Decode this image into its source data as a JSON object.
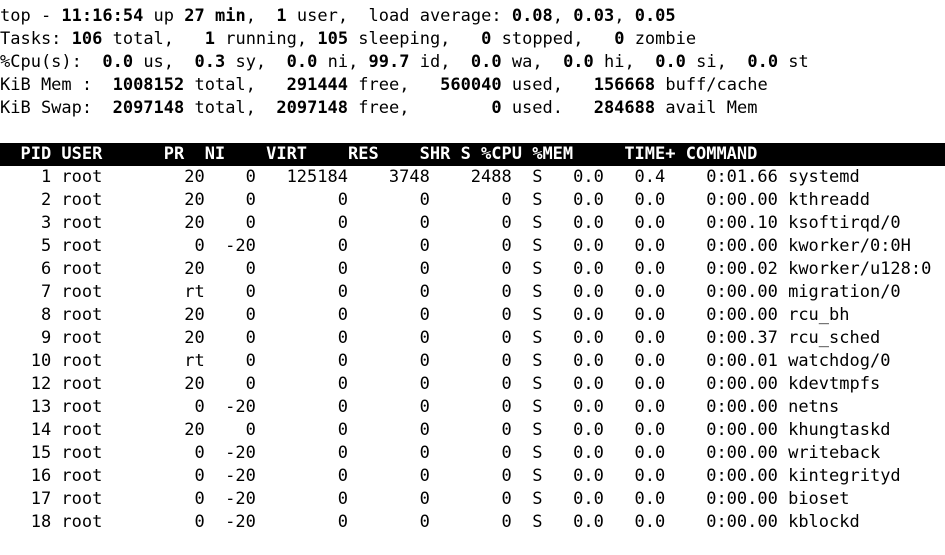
{
  "terminal": {
    "program": "top",
    "background_color": "#ffffff",
    "foreground_color": "#000000",
    "header_bar_background": "#000000",
    "header_bar_foreground": "#ffffff"
  },
  "summary": {
    "uptime_line": {
      "program": "top",
      "separator": "-",
      "time": "11:16:54",
      "up_label": "up",
      "uptime": "27 min,",
      "users_count": "1",
      "users_label": "user,",
      "load_label": "load average:",
      "load_1min": "0.08,",
      "load_5min": "0.03,",
      "load_15min": "0.05",
      "full_text": "top - 11:16:54 up 27 min,  1 user,  load average: 0.08, 0.03, 0.05"
    },
    "tasks_line": {
      "label": "Tasks:",
      "total": "106",
      "total_label": "total,",
      "running": "1",
      "running_label": "running,",
      "sleeping": "105",
      "sleeping_label": "sleeping,",
      "stopped": "0",
      "stopped_label": "stopped,",
      "zombie": "0",
      "zombie_label": "zombie",
      "full_text": "Tasks: 106 total,   1 running, 105 sleeping,   0 stopped,   0 zombie"
    },
    "cpu_line": {
      "label": "%Cpu(s):",
      "us": "0.0",
      "us_label": "us,",
      "sy": "0.3",
      "sy_label": "sy,",
      "ni": "0.0",
      "ni_label": "ni,",
      "id": "99.7",
      "id_label": "id,",
      "wa": "0.0",
      "wa_label": "wa,",
      "hi": "0.0",
      "hi_label": "hi,",
      "si": "0.0",
      "si_label": "si,",
      "st": "0.0",
      "st_label": "st",
      "full_text": "%Cpu(s):  0.0 us,  0.3 sy,  0.0 ni, 99.7 id,  0.0 wa,  0.0 hi,  0.0 si,  0.0 st"
    },
    "mem_line": {
      "label": "KiB Mem :",
      "total": "1008152",
      "total_label": "total,",
      "free": "291444",
      "free_label": "free,",
      "used": "560040",
      "used_label": "used,",
      "buff_cache": "156668",
      "buff_cache_label": "buff/cache",
      "full_text": "KiB Mem :  1008152 total,   291444 free,   560040 used,   156668 buff/cache"
    },
    "swap_line": {
      "label": "KiB Swap:",
      "total": "2097148",
      "total_label": "total,",
      "free": "2097148",
      "free_label": "free,",
      "used": "0",
      "used_label": "used.",
      "avail": "284688",
      "avail_label": "avail Mem",
      "full_text": "KiB Swap:  2097148 total,  2097148 free,        0 used.   284688 avail Mem"
    }
  },
  "table": {
    "columns": [
      {
        "key": "pid",
        "label": "PID",
        "width": 5,
        "align": "right"
      },
      {
        "key": "user",
        "label": "USER",
        "width": 9,
        "align": "left"
      },
      {
        "key": "pr",
        "label": "PR",
        "width": 4,
        "align": "right"
      },
      {
        "key": "ni",
        "label": "NI",
        "width": 4,
        "align": "right"
      },
      {
        "key": "virt",
        "label": "VIRT",
        "width": 8,
        "align": "right"
      },
      {
        "key": "res",
        "label": "RES",
        "width": 7,
        "align": "right"
      },
      {
        "key": "shr",
        "label": "SHR",
        "width": 7,
        "align": "right"
      },
      {
        "key": "s",
        "label": "S",
        "width": 2,
        "align": "right"
      },
      {
        "key": "cpu",
        "label": "%CPU",
        "width": 5,
        "align": "right"
      },
      {
        "key": "mem",
        "label": "%MEM",
        "width": 5,
        "align": "right"
      },
      {
        "key": "time",
        "label": "TIME+",
        "width": 10,
        "align": "right"
      },
      {
        "key": "command",
        "label": "COMMAND",
        "width": 0,
        "align": "left"
      }
    ],
    "header_text": "  PID USER      PR  NI    VIRT    RES    SHR S %CPU %MEM     TIME+ COMMAND                                       ",
    "rows": [
      {
        "pid": "1",
        "user": "root",
        "pr": "20",
        "ni": "0",
        "virt": "125184",
        "res": "3748",
        "shr": "2488",
        "s": "S",
        "cpu": "0.0",
        "mem": "0.4",
        "time": "0:01.66",
        "command": "systemd"
      },
      {
        "pid": "2",
        "user": "root",
        "pr": "20",
        "ni": "0",
        "virt": "0",
        "res": "0",
        "shr": "0",
        "s": "S",
        "cpu": "0.0",
        "mem": "0.0",
        "time": "0:00.00",
        "command": "kthreadd"
      },
      {
        "pid": "3",
        "user": "root",
        "pr": "20",
        "ni": "0",
        "virt": "0",
        "res": "0",
        "shr": "0",
        "s": "S",
        "cpu": "0.0",
        "mem": "0.0",
        "time": "0:00.10",
        "command": "ksoftirqd/0"
      },
      {
        "pid": "5",
        "user": "root",
        "pr": "0",
        "ni": "-20",
        "virt": "0",
        "res": "0",
        "shr": "0",
        "s": "S",
        "cpu": "0.0",
        "mem": "0.0",
        "time": "0:00.00",
        "command": "kworker/0:0H"
      },
      {
        "pid": "6",
        "user": "root",
        "pr": "20",
        "ni": "0",
        "virt": "0",
        "res": "0",
        "shr": "0",
        "s": "S",
        "cpu": "0.0",
        "mem": "0.0",
        "time": "0:00.02",
        "command": "kworker/u128:0"
      },
      {
        "pid": "7",
        "user": "root",
        "pr": "rt",
        "ni": "0",
        "virt": "0",
        "res": "0",
        "shr": "0",
        "s": "S",
        "cpu": "0.0",
        "mem": "0.0",
        "time": "0:00.00",
        "command": "migration/0"
      },
      {
        "pid": "8",
        "user": "root",
        "pr": "20",
        "ni": "0",
        "virt": "0",
        "res": "0",
        "shr": "0",
        "s": "S",
        "cpu": "0.0",
        "mem": "0.0",
        "time": "0:00.00",
        "command": "rcu_bh"
      },
      {
        "pid": "9",
        "user": "root",
        "pr": "20",
        "ni": "0",
        "virt": "0",
        "res": "0",
        "shr": "0",
        "s": "S",
        "cpu": "0.0",
        "mem": "0.0",
        "time": "0:00.37",
        "command": "rcu_sched"
      },
      {
        "pid": "10",
        "user": "root",
        "pr": "rt",
        "ni": "0",
        "virt": "0",
        "res": "0",
        "shr": "0",
        "s": "S",
        "cpu": "0.0",
        "mem": "0.0",
        "time": "0:00.01",
        "command": "watchdog/0"
      },
      {
        "pid": "12",
        "user": "root",
        "pr": "20",
        "ni": "0",
        "virt": "0",
        "res": "0",
        "shr": "0",
        "s": "S",
        "cpu": "0.0",
        "mem": "0.0",
        "time": "0:00.00",
        "command": "kdevtmpfs"
      },
      {
        "pid": "13",
        "user": "root",
        "pr": "0",
        "ni": "-20",
        "virt": "0",
        "res": "0",
        "shr": "0",
        "s": "S",
        "cpu": "0.0",
        "mem": "0.0",
        "time": "0:00.00",
        "command": "netns"
      },
      {
        "pid": "14",
        "user": "root",
        "pr": "20",
        "ni": "0",
        "virt": "0",
        "res": "0",
        "shr": "0",
        "s": "S",
        "cpu": "0.0",
        "mem": "0.0",
        "time": "0:00.00",
        "command": "khungtaskd"
      },
      {
        "pid": "15",
        "user": "root",
        "pr": "0",
        "ni": "-20",
        "virt": "0",
        "res": "0",
        "shr": "0",
        "s": "S",
        "cpu": "0.0",
        "mem": "0.0",
        "time": "0:00.00",
        "command": "writeback"
      },
      {
        "pid": "16",
        "user": "root",
        "pr": "0",
        "ni": "-20",
        "virt": "0",
        "res": "0",
        "shr": "0",
        "s": "S",
        "cpu": "0.0",
        "mem": "0.0",
        "time": "0:00.00",
        "command": "kintegrityd"
      },
      {
        "pid": "17",
        "user": "root",
        "pr": "0",
        "ni": "-20",
        "virt": "0",
        "res": "0",
        "shr": "0",
        "s": "S",
        "cpu": "0.0",
        "mem": "0.0",
        "time": "0:00.00",
        "command": "bioset"
      },
      {
        "pid": "18",
        "user": "root",
        "pr": "0",
        "ni": "-20",
        "virt": "0",
        "res": "0",
        "shr": "0",
        "s": "S",
        "cpu": "0.0",
        "mem": "0.0",
        "time": "0:00.00",
        "command": "kblockd"
      }
    ]
  }
}
